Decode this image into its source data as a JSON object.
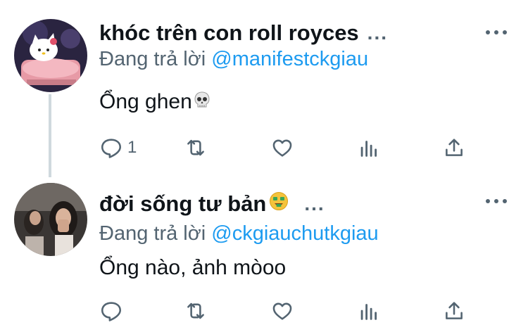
{
  "tweets": [
    {
      "display_name": "khóc trên con roll royces",
      "name_ellipsis": "...",
      "reply_prefix": "Đang trả lời",
      "reply_handle": "@manifestckgiau",
      "text": "Ổng ghen",
      "emoji_icon": "skull-icon",
      "reply_count": "1"
    },
    {
      "display_name": "đời sống tư bản",
      "name_ellipsis": "...",
      "name_emoji_icon": "money-mouth-face-icon",
      "reply_prefix": "Đang trả lời",
      "reply_handle": "@ckgiauchutkgiau",
      "text": "Ổng nào, ảnh mòoo",
      "reply_count": ""
    }
  ],
  "colors": {
    "accent": "#1d9bf0",
    "secondary_text": "#536471",
    "thread_line": "#cfd9de",
    "avatar1_bg": "#2a2440",
    "avatar2_bg": "#3a3634"
  }
}
